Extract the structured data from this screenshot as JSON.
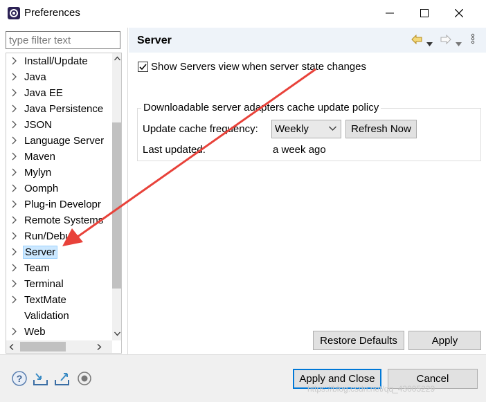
{
  "window": {
    "title": "Preferences"
  },
  "filter": {
    "placeholder": "type filter text"
  },
  "tree": {
    "items": [
      {
        "label": "Install/Update",
        "expandable": true
      },
      {
        "label": "Java",
        "expandable": true
      },
      {
        "label": "Java EE",
        "expandable": true
      },
      {
        "label": "Java Persistence",
        "expandable": true
      },
      {
        "label": "JSON",
        "expandable": true
      },
      {
        "label": "Language Server",
        "expandable": true
      },
      {
        "label": "Maven",
        "expandable": true
      },
      {
        "label": "Mylyn",
        "expandable": true
      },
      {
        "label": "Oomph",
        "expandable": true
      },
      {
        "label": "Plug-in Developr",
        "expandable": true
      },
      {
        "label": "Remote Systems",
        "expandable": true
      },
      {
        "label": "Run/Debug",
        "expandable": true
      },
      {
        "label": "Server",
        "expandable": true,
        "selected": true
      },
      {
        "label": "Team",
        "expandable": true
      },
      {
        "label": "Terminal",
        "expandable": true
      },
      {
        "label": "TextMate",
        "expandable": true
      },
      {
        "label": "Validation",
        "expandable": false
      },
      {
        "label": "Web",
        "expandable": true
      }
    ]
  },
  "page": {
    "title": "Server",
    "show_servers_label": "Show Servers view when server state changes",
    "show_servers_checked": true,
    "group_title": "Downloadable server adapters cache update policy",
    "freq_label": "Update cache frequency:",
    "freq_value": "Weekly",
    "refresh_label": "Refresh Now",
    "last_updated_label": "Last updated:",
    "last_updated_value": "a week ago",
    "restore_defaults_label": "Restore Defaults",
    "apply_label": "Apply"
  },
  "footer": {
    "apply_close_label": "Apply and Close",
    "cancel_label": "Cancel",
    "icons": [
      "help-icon",
      "import-icon",
      "export-icon",
      "record-icon"
    ]
  },
  "overlay": {
    "watermark": "https://blog.csdn.net/qq_43005229",
    "arrow_color": "#e8423a"
  }
}
